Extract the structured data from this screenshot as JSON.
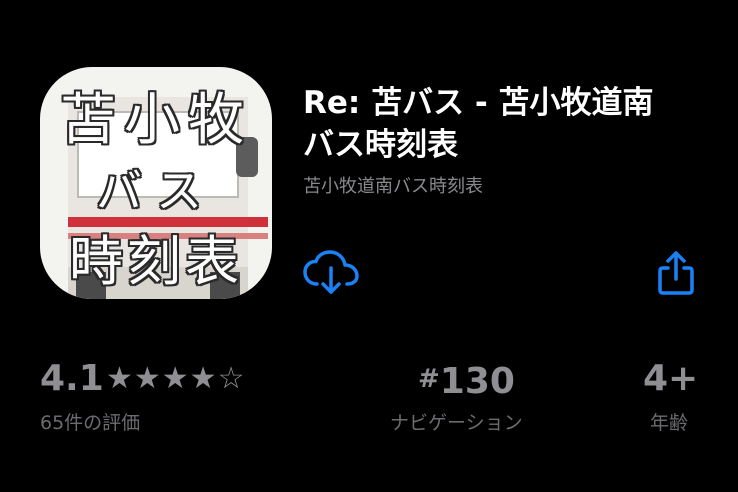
{
  "app": {
    "icon_text": {
      "line1": "苫小牧",
      "line2": "バス",
      "line3": "時刻表"
    },
    "title_line1": "Re: 苫バス - 苫小牧道南",
    "title_line2": "バス時刻表",
    "subtitle": "苫小牧道南バス時刻表"
  },
  "actions": {
    "download_icon": "icloud-download-icon",
    "share_icon": "share-icon",
    "accent_color": "#1a82f7"
  },
  "stats": {
    "rating": {
      "value": "4.1",
      "stars": "★★★★☆",
      "label": "65件の評価"
    },
    "rank": {
      "hash": "#",
      "value": "130",
      "label": "ナビゲーション"
    },
    "age": {
      "value": "4+",
      "label": "年齢"
    }
  }
}
